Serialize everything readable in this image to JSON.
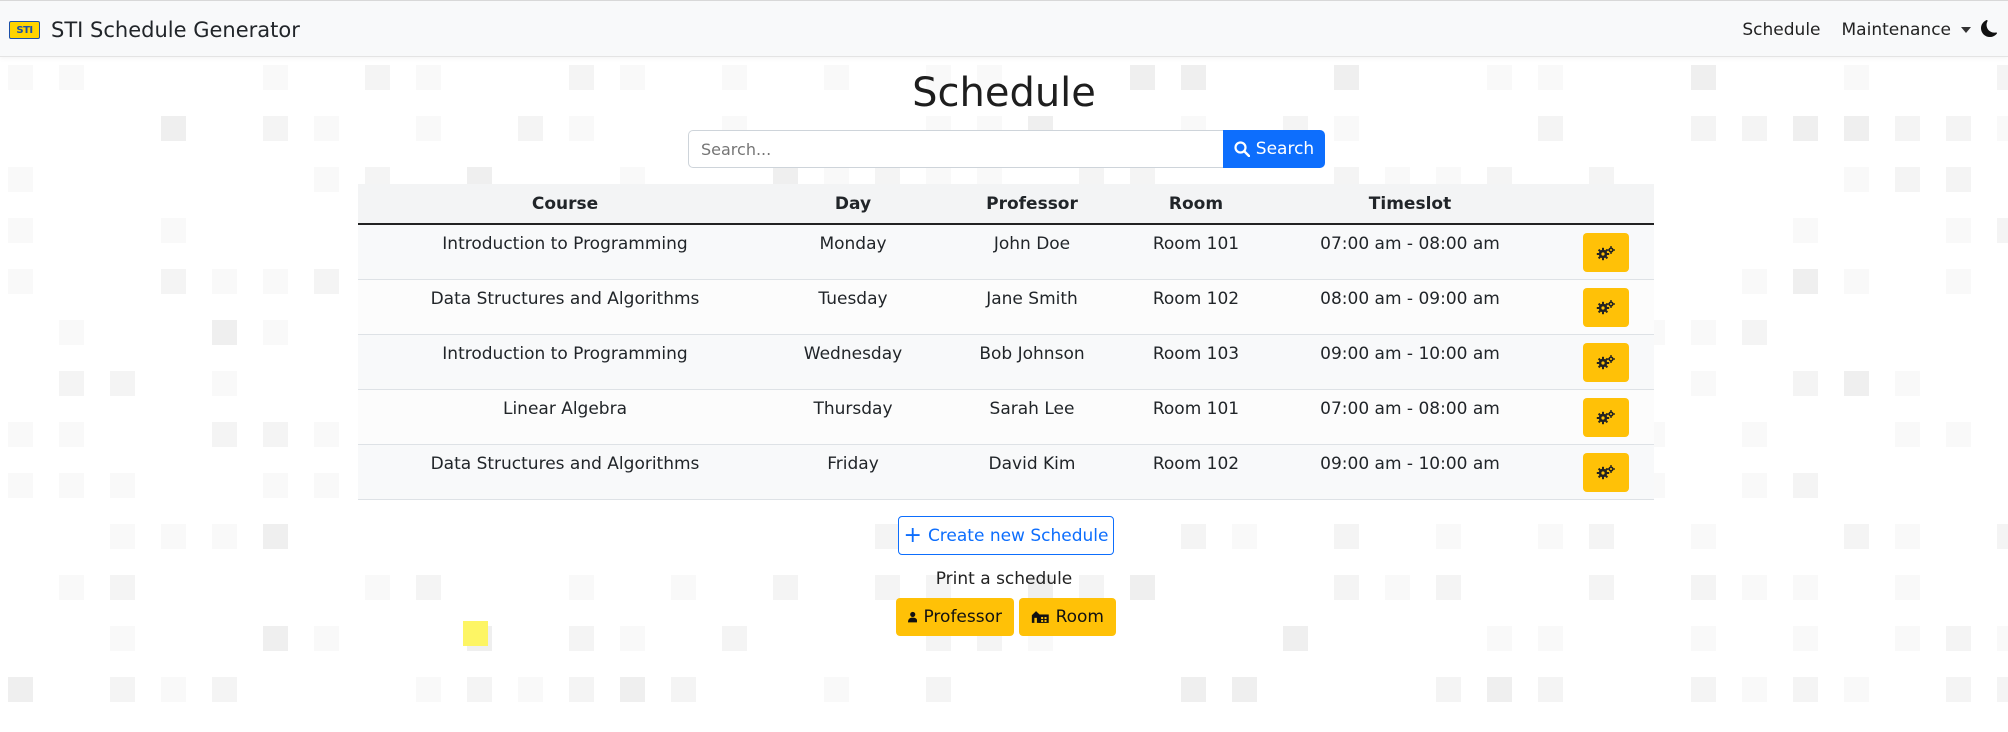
{
  "navbar": {
    "logo_text": "STI",
    "brand": "STI Schedule Generator",
    "links": {
      "schedule": "Schedule",
      "maintenance": "Maintenance"
    }
  },
  "page": {
    "title": "Schedule",
    "search": {
      "placeholder": "Search...",
      "button": "Search"
    }
  },
  "table": {
    "headers": {
      "course": "Course",
      "day": "Day",
      "professor": "Professor",
      "room": "Room",
      "timeslot": "Timeslot"
    },
    "rows": [
      {
        "course": "Introduction to Programming",
        "day": "Monday",
        "professor": "John Doe",
        "room": "Room 101",
        "timeslot": "07:00 am - 08:00 am"
      },
      {
        "course": "Data Structures and Algorithms",
        "day": "Tuesday",
        "professor": "Jane Smith",
        "room": "Room 102",
        "timeslot": "08:00 am - 09:00 am"
      },
      {
        "course": "Introduction to Programming",
        "day": "Wednesday",
        "professor": "Bob Johnson",
        "room": "Room 103",
        "timeslot": "09:00 am - 10:00 am"
      },
      {
        "course": "Linear Algebra",
        "day": "Thursday",
        "professor": "Sarah Lee",
        "room": "Room 101",
        "timeslot": "07:00 am - 08:00 am"
      },
      {
        "course": "Data Structures and Algorithms",
        "day": "Friday",
        "professor": "David Kim",
        "room": "Room 102",
        "timeslot": "09:00 am - 10:00 am"
      }
    ]
  },
  "actions": {
    "create_label": "Create new Schedule",
    "print_label": "Print a schedule",
    "print_professor": "Professor",
    "print_room": "Room"
  },
  "icons": {
    "search": "search-icon",
    "row_action": "gears-icon",
    "create": "plus-icon",
    "professor": "user-icon",
    "room": "building-icon",
    "theme": "moon-icon"
  },
  "colors": {
    "primary": "#0d6efd",
    "warning": "#ffc107",
    "navbar_bg": "#f8f9fa"
  }
}
